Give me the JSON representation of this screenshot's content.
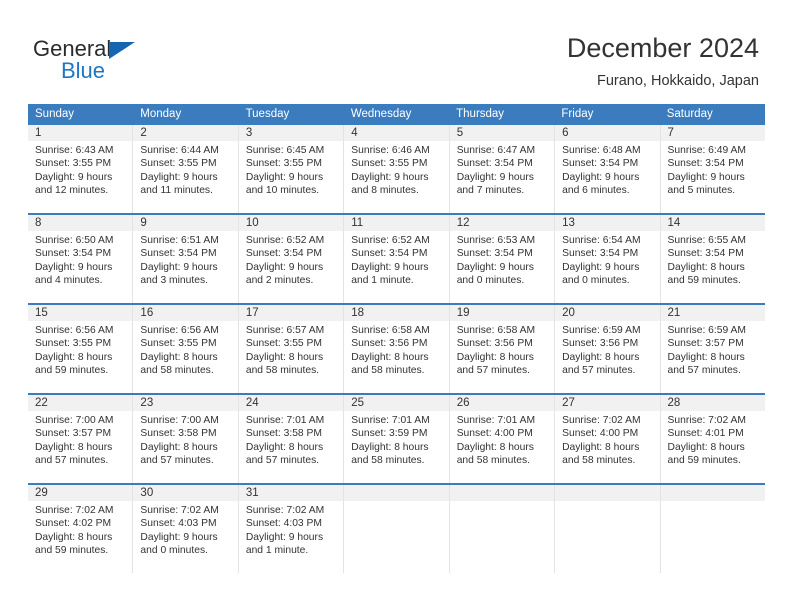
{
  "brand": {
    "name_top": "General",
    "name_bottom": "Blue",
    "triangle_icon": "blue-triangle-icon",
    "accent_color": "#1565b0"
  },
  "header": {
    "title": "December 2024",
    "subtitle": "Furano, Hokkaido, Japan"
  },
  "theme": {
    "header_blue": "#3b7cbf",
    "day_number_band": "#f1f1f1",
    "grid_line": "#e4e4e4",
    "text": "#333333"
  },
  "weekdays": [
    "Sunday",
    "Monday",
    "Tuesday",
    "Wednesday",
    "Thursday",
    "Friday",
    "Saturday"
  ],
  "weeks": [
    [
      {
        "day": "1",
        "sunrise": "Sunrise: 6:43 AM",
        "sunset": "Sunset: 3:55 PM",
        "daylight_1": "Daylight: 9 hours",
        "daylight_2": "and 12 minutes."
      },
      {
        "day": "2",
        "sunrise": "Sunrise: 6:44 AM",
        "sunset": "Sunset: 3:55 PM",
        "daylight_1": "Daylight: 9 hours",
        "daylight_2": "and 11 minutes."
      },
      {
        "day": "3",
        "sunrise": "Sunrise: 6:45 AM",
        "sunset": "Sunset: 3:55 PM",
        "daylight_1": "Daylight: 9 hours",
        "daylight_2": "and 10 minutes."
      },
      {
        "day": "4",
        "sunrise": "Sunrise: 6:46 AM",
        "sunset": "Sunset: 3:55 PM",
        "daylight_1": "Daylight: 9 hours",
        "daylight_2": "and 8 minutes."
      },
      {
        "day": "5",
        "sunrise": "Sunrise: 6:47 AM",
        "sunset": "Sunset: 3:54 PM",
        "daylight_1": "Daylight: 9 hours",
        "daylight_2": "and 7 minutes."
      },
      {
        "day": "6",
        "sunrise": "Sunrise: 6:48 AM",
        "sunset": "Sunset: 3:54 PM",
        "daylight_1": "Daylight: 9 hours",
        "daylight_2": "and 6 minutes."
      },
      {
        "day": "7",
        "sunrise": "Sunrise: 6:49 AM",
        "sunset": "Sunset: 3:54 PM",
        "daylight_1": "Daylight: 9 hours",
        "daylight_2": "and 5 minutes."
      }
    ],
    [
      {
        "day": "8",
        "sunrise": "Sunrise: 6:50 AM",
        "sunset": "Sunset: 3:54 PM",
        "daylight_1": "Daylight: 9 hours",
        "daylight_2": "and 4 minutes."
      },
      {
        "day": "9",
        "sunrise": "Sunrise: 6:51 AM",
        "sunset": "Sunset: 3:54 PM",
        "daylight_1": "Daylight: 9 hours",
        "daylight_2": "and 3 minutes."
      },
      {
        "day": "10",
        "sunrise": "Sunrise: 6:52 AM",
        "sunset": "Sunset: 3:54 PM",
        "daylight_1": "Daylight: 9 hours",
        "daylight_2": "and 2 minutes."
      },
      {
        "day": "11",
        "sunrise": "Sunrise: 6:52 AM",
        "sunset": "Sunset: 3:54 PM",
        "daylight_1": "Daylight: 9 hours",
        "daylight_2": "and 1 minute."
      },
      {
        "day": "12",
        "sunrise": "Sunrise: 6:53 AM",
        "sunset": "Sunset: 3:54 PM",
        "daylight_1": "Daylight: 9 hours",
        "daylight_2": "and 0 minutes."
      },
      {
        "day": "13",
        "sunrise": "Sunrise: 6:54 AM",
        "sunset": "Sunset: 3:54 PM",
        "daylight_1": "Daylight: 9 hours",
        "daylight_2": "and 0 minutes."
      },
      {
        "day": "14",
        "sunrise": "Sunrise: 6:55 AM",
        "sunset": "Sunset: 3:54 PM",
        "daylight_1": "Daylight: 8 hours",
        "daylight_2": "and 59 minutes."
      }
    ],
    [
      {
        "day": "15",
        "sunrise": "Sunrise: 6:56 AM",
        "sunset": "Sunset: 3:55 PM",
        "daylight_1": "Daylight: 8 hours",
        "daylight_2": "and 59 minutes."
      },
      {
        "day": "16",
        "sunrise": "Sunrise: 6:56 AM",
        "sunset": "Sunset: 3:55 PM",
        "daylight_1": "Daylight: 8 hours",
        "daylight_2": "and 58 minutes."
      },
      {
        "day": "17",
        "sunrise": "Sunrise: 6:57 AM",
        "sunset": "Sunset: 3:55 PM",
        "daylight_1": "Daylight: 8 hours",
        "daylight_2": "and 58 minutes."
      },
      {
        "day": "18",
        "sunrise": "Sunrise: 6:58 AM",
        "sunset": "Sunset: 3:56 PM",
        "daylight_1": "Daylight: 8 hours",
        "daylight_2": "and 58 minutes."
      },
      {
        "day": "19",
        "sunrise": "Sunrise: 6:58 AM",
        "sunset": "Sunset: 3:56 PM",
        "daylight_1": "Daylight: 8 hours",
        "daylight_2": "and 57 minutes."
      },
      {
        "day": "20",
        "sunrise": "Sunrise: 6:59 AM",
        "sunset": "Sunset: 3:56 PM",
        "daylight_1": "Daylight: 8 hours",
        "daylight_2": "and 57 minutes."
      },
      {
        "day": "21",
        "sunrise": "Sunrise: 6:59 AM",
        "sunset": "Sunset: 3:57 PM",
        "daylight_1": "Daylight: 8 hours",
        "daylight_2": "and 57 minutes."
      }
    ],
    [
      {
        "day": "22",
        "sunrise": "Sunrise: 7:00 AM",
        "sunset": "Sunset: 3:57 PM",
        "daylight_1": "Daylight: 8 hours",
        "daylight_2": "and 57 minutes."
      },
      {
        "day": "23",
        "sunrise": "Sunrise: 7:00 AM",
        "sunset": "Sunset: 3:58 PM",
        "daylight_1": "Daylight: 8 hours",
        "daylight_2": "and 57 minutes."
      },
      {
        "day": "24",
        "sunrise": "Sunrise: 7:01 AM",
        "sunset": "Sunset: 3:58 PM",
        "daylight_1": "Daylight: 8 hours",
        "daylight_2": "and 57 minutes."
      },
      {
        "day": "25",
        "sunrise": "Sunrise: 7:01 AM",
        "sunset": "Sunset: 3:59 PM",
        "daylight_1": "Daylight: 8 hours",
        "daylight_2": "and 58 minutes."
      },
      {
        "day": "26",
        "sunrise": "Sunrise: 7:01 AM",
        "sunset": "Sunset: 4:00 PM",
        "daylight_1": "Daylight: 8 hours",
        "daylight_2": "and 58 minutes."
      },
      {
        "day": "27",
        "sunrise": "Sunrise: 7:02 AM",
        "sunset": "Sunset: 4:00 PM",
        "daylight_1": "Daylight: 8 hours",
        "daylight_2": "and 58 minutes."
      },
      {
        "day": "28",
        "sunrise": "Sunrise: 7:02 AM",
        "sunset": "Sunset: 4:01 PM",
        "daylight_1": "Daylight: 8 hours",
        "daylight_2": "and 59 minutes."
      }
    ],
    [
      {
        "day": "29",
        "sunrise": "Sunrise: 7:02 AM",
        "sunset": "Sunset: 4:02 PM",
        "daylight_1": "Daylight: 8 hours",
        "daylight_2": "and 59 minutes."
      },
      {
        "day": "30",
        "sunrise": "Sunrise: 7:02 AM",
        "sunset": "Sunset: 4:03 PM",
        "daylight_1": "Daylight: 9 hours",
        "daylight_2": "and 0 minutes."
      },
      {
        "day": "31",
        "sunrise": "Sunrise: 7:02 AM",
        "sunset": "Sunset: 4:03 PM",
        "daylight_1": "Daylight: 9 hours",
        "daylight_2": "and 1 minute."
      },
      {
        "day": "",
        "sunrise": "",
        "sunset": "",
        "daylight_1": "",
        "daylight_2": ""
      },
      {
        "day": "",
        "sunrise": "",
        "sunset": "",
        "daylight_1": "",
        "daylight_2": ""
      },
      {
        "day": "",
        "sunrise": "",
        "sunset": "",
        "daylight_1": "",
        "daylight_2": ""
      },
      {
        "day": "",
        "sunrise": "",
        "sunset": "",
        "daylight_1": "",
        "daylight_2": ""
      }
    ]
  ]
}
